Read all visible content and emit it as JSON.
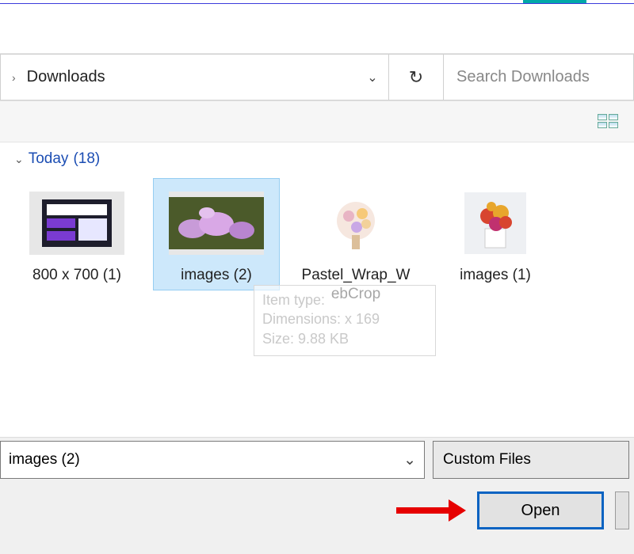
{
  "nav": {
    "folder": "Downloads",
    "search_placeholder": "Search Downloads"
  },
  "group": {
    "label": "Today",
    "count": "(18)"
  },
  "items": [
    {
      "name": "800 x 700 (1)"
    },
    {
      "name": "images (2)",
      "selected": true
    },
    {
      "name": "Pastel_Wrap_WebCrop"
    },
    {
      "name": "images (1)"
    }
  ],
  "tooltip": {
    "line1": "Item type:",
    "line2": "Dimensions:       x 169",
    "line3": "Size: 9.88 KB"
  },
  "footer": {
    "filename": "images (2)",
    "filter": "Custom Files",
    "open_label": "Open"
  }
}
